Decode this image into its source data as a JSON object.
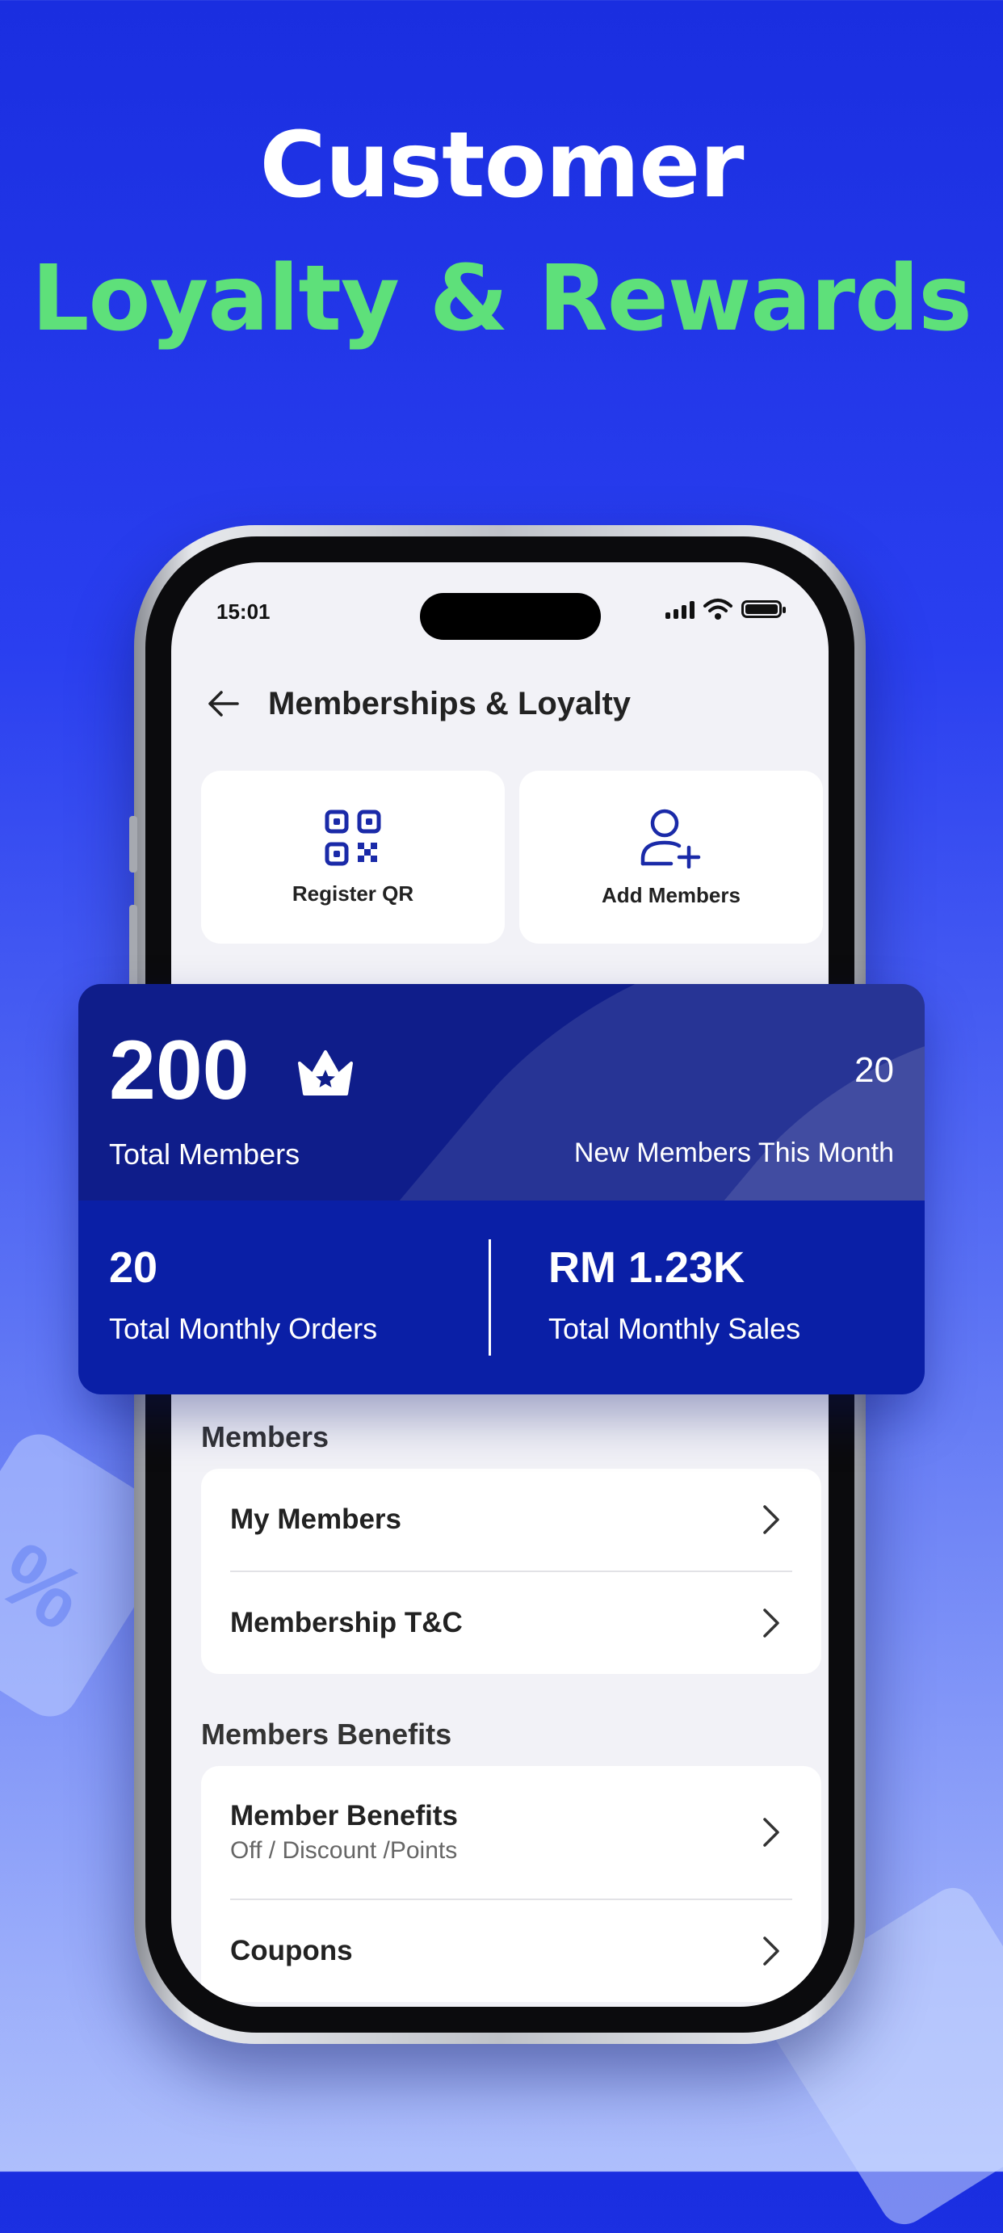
{
  "headline": {
    "line1": "Customer",
    "line2": "Loyalty & Rewards"
  },
  "status_bar": {
    "time": "15:01"
  },
  "navbar": {
    "title": "Memberships & Loyalty"
  },
  "actions": [
    {
      "label": "Register QR",
      "icon": "qr-code-icon"
    },
    {
      "label": "Add Members",
      "icon": "user-add-icon"
    }
  ],
  "stats": {
    "total_members": {
      "value": "200",
      "label": "Total Members"
    },
    "new_members": {
      "value": "20",
      "label": "New Members This Month"
    },
    "monthly_orders": {
      "value": "20",
      "label": "Total Monthly Orders"
    },
    "monthly_sales": {
      "value": "RM 1.23K",
      "label": "Total Monthly Sales"
    }
  },
  "members_section": {
    "title": "Members",
    "items": [
      {
        "label": "My Members"
      },
      {
        "label": "Membership T&C"
      }
    ]
  },
  "benefits_section": {
    "title": "Members Benefits",
    "items": [
      {
        "label": "Member Benefits",
        "sub": "Off / Discount /Points"
      },
      {
        "label": "Coupons"
      }
    ]
  },
  "colors": {
    "accent_green": "#5ee07a",
    "primary_blue": "#0f1d8a",
    "icon_blue": "#1a2aa8"
  }
}
